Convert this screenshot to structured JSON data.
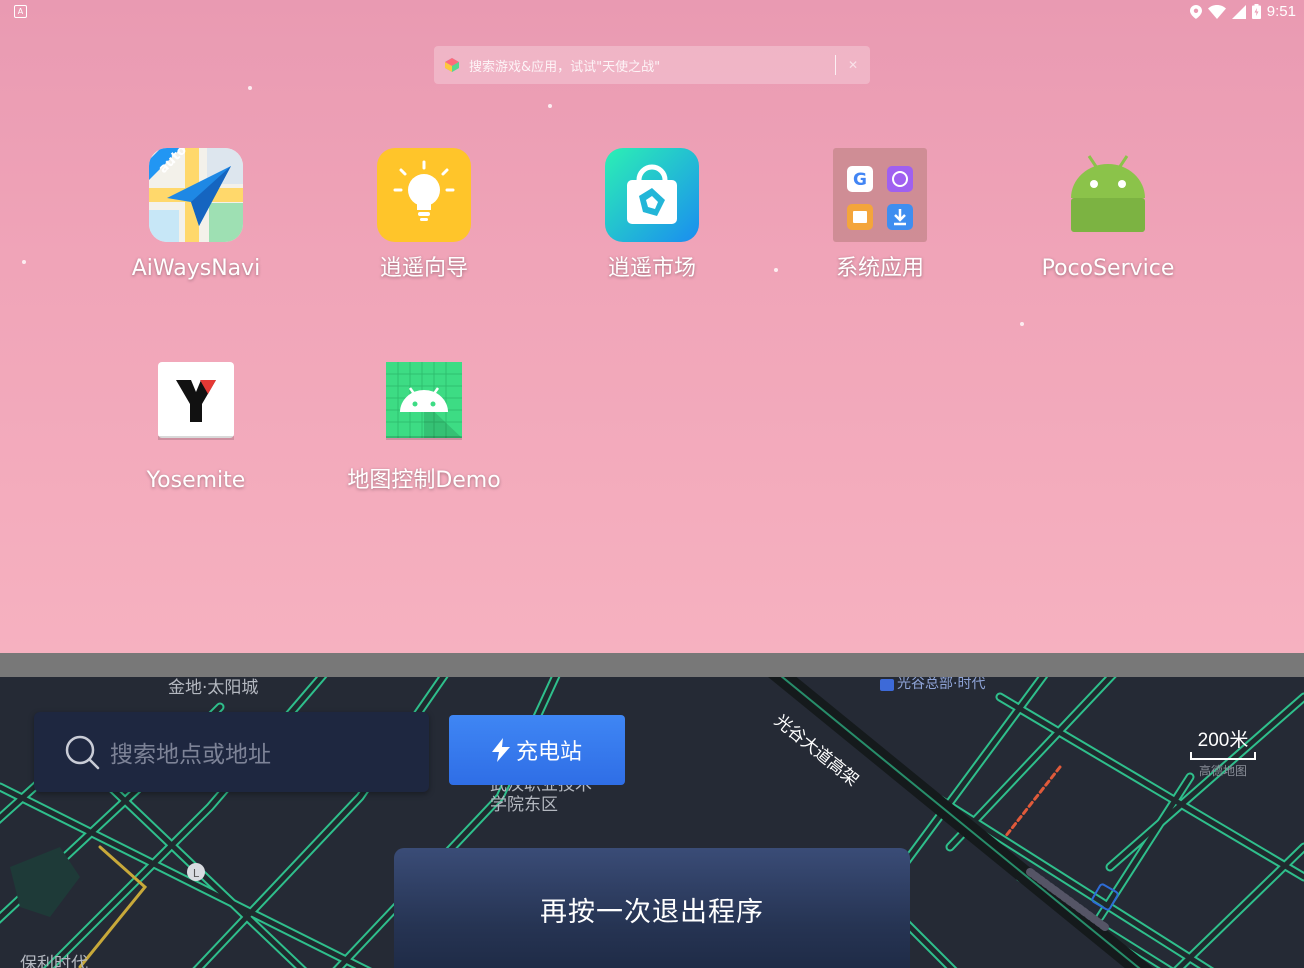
{
  "status_bar": {
    "left_icon_glyph": "A",
    "time": "9:51",
    "icons": [
      "location-icon",
      "wifi-icon",
      "signal-icon",
      "battery-icon"
    ]
  },
  "launcher": {
    "search": {
      "placeholder": "搜索游戏&应用，试试\"天使之战\"",
      "clear_glyph": "✕"
    },
    "apps": [
      {
        "name": "AiWaysNavi",
        "icon": "aiways-navi-icon"
      },
      {
        "name": "逍遥向导",
        "icon": "lightbulb-icon"
      },
      {
        "name": "逍遥市场",
        "icon": "shopping-bag-icon"
      },
      {
        "name": "系统应用",
        "icon": "folder-icon"
      },
      {
        "name": "PocoService",
        "icon": "android-robot-icon"
      },
      {
        "name": "Yosemite",
        "icon": "yosemite-icon"
      },
      {
        "name": "地图控制Demo",
        "icon": "android-grid-icon"
      }
    ],
    "accent": "#f0a4b8"
  },
  "map": {
    "labels": {
      "top_left": "金地·太阳城",
      "college": "武汉职业技术学院东区",
      "expressway": "光谷大道高架",
      "poi": "光谷总部·时代",
      "bottom_left": "保利时代"
    },
    "search_placeholder": "搜索地点或地址",
    "charge_button": "充电站",
    "scale": {
      "value": "200米",
      "brand": "高德地图"
    },
    "toast": "再按一次退出程序",
    "colors": {
      "road_edge": "#2fbf8c",
      "background": "#252a35",
      "button": "#3479ee"
    }
  }
}
